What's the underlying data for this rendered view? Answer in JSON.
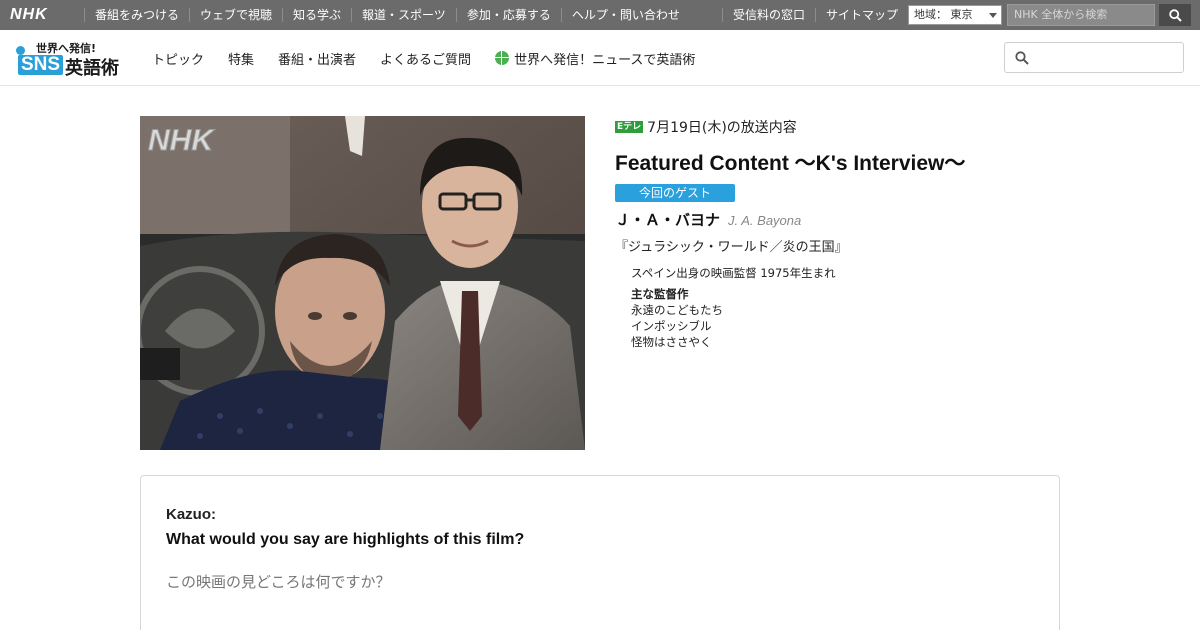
{
  "nhkbar": {
    "logo": "NHK",
    "nav": [
      "番組をみつける",
      "ウェブで視聴",
      "知る学ぶ",
      "報道・スポーツ",
      "参加・応募する",
      "ヘルプ・問い合わせ"
    ],
    "right": [
      "受信料の窓口",
      "サイトマップ"
    ],
    "region_label": "地域： 東京",
    "search_placeholder": "NHK 全体から検索"
  },
  "site": {
    "logo_top": "世界へ発信!",
    "logo_sns": "SNS",
    "logo_ja": "英語術",
    "nav": [
      "トピック",
      "特集",
      "番組・出演者",
      "よくあるご質問"
    ],
    "nav_special": "世界へ発信！ニュースで英語術"
  },
  "photo": {
    "nhk_mark": "NHK"
  },
  "episode": {
    "channel_badge": "Eテレ",
    "air_date": "7月19日(木)の放送内容",
    "title": "Featured Content 〜K's Interview〜",
    "guest_badge": "今回のゲスト",
    "guest_name_ja": "Ｊ・Ａ・バヨナ",
    "guest_name_en": "J. A. Bayona",
    "film": "『ジュラシック・ワールド／炎の王国』",
    "bio": "スペイン出身の映画監督 1975年生まれ",
    "works_label": "主な監督作",
    "works": [
      "永遠のこどもたち",
      "インポッシブル",
      "怪物はささやく"
    ]
  },
  "qa": {
    "speaker": "Kazuo:",
    "question": "What would you say are highlights of this film?",
    "translation": "この映画の見どころは何ですか？"
  },
  "colors": {
    "nhkbar": "#6b6b6b",
    "accent_blue": "#2aa0dc",
    "etele_green": "#2e9e3c"
  }
}
